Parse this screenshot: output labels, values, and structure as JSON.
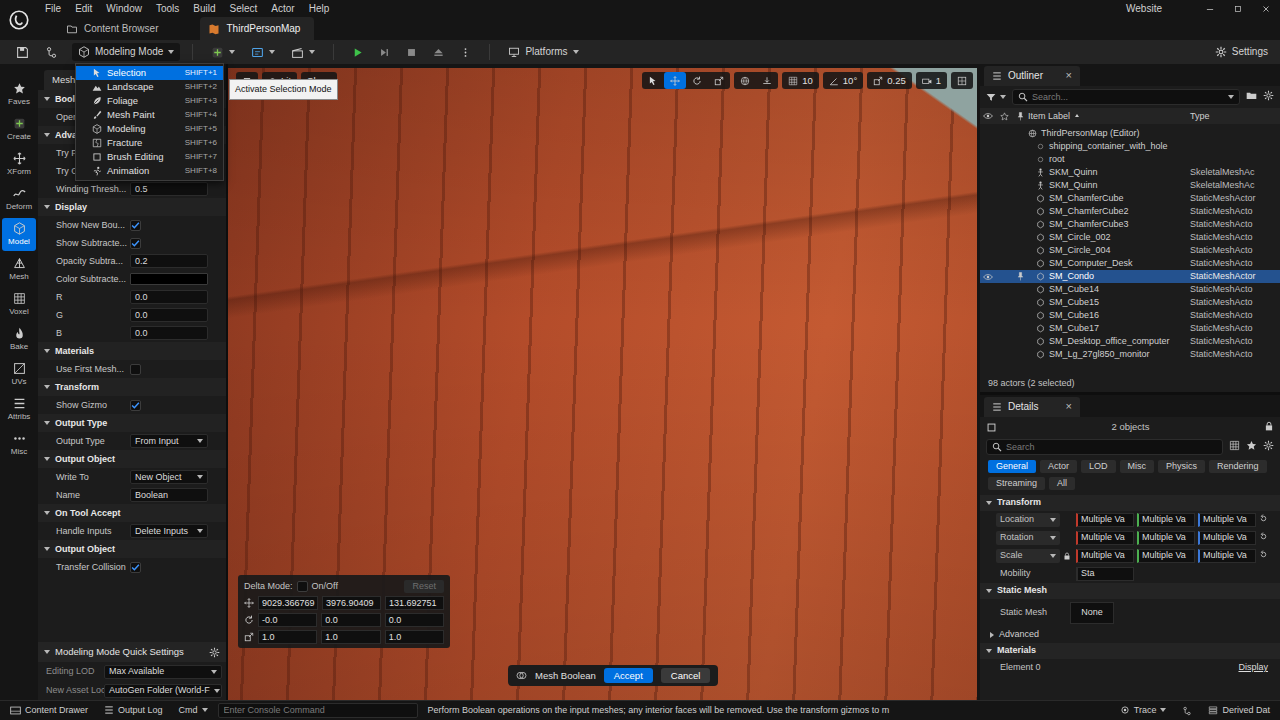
{
  "menu_bar": {
    "items": [
      "File",
      "Edit",
      "Window",
      "Tools",
      "Build",
      "Select",
      "Actor",
      "Help"
    ],
    "website": "Website"
  },
  "doc_tabs": [
    {
      "label": "Content Browser",
      "selected": false
    },
    {
      "label": "ThirdPersonMap",
      "selected": true
    }
  ],
  "toolbar": {
    "mode": "Modeling Mode",
    "platforms": "Platforms",
    "settings": "Settings"
  },
  "mode_menu": {
    "items": [
      {
        "label": "Selection",
        "shortcut": "SHIFT+1",
        "selected": true
      },
      {
        "label": "Landscape",
        "shortcut": "SHIFT+2",
        "selected": false
      },
      {
        "label": "Foliage",
        "shortcut": "SHIFT+3",
        "selected": false
      },
      {
        "label": "Mesh Paint",
        "shortcut": "SHIFT+4",
        "selected": false
      },
      {
        "label": "Modeling",
        "shortcut": "SHIFT+5",
        "selected": false
      },
      {
        "label": "Fracture",
        "shortcut": "SHIFT+6",
        "selected": false
      },
      {
        "label": "Brush Editing",
        "shortcut": "SHIFT+7",
        "selected": false
      },
      {
        "label": "Animation",
        "shortcut": "SHIFT+8",
        "selected": false
      }
    ],
    "tooltip": "Activate Selection Mode"
  },
  "tool_strip": [
    {
      "label": "Faves",
      "selected": false
    },
    {
      "label": "Create",
      "selected": false
    },
    {
      "label": "XForm",
      "selected": false
    },
    {
      "label": "Deform",
      "selected": false
    },
    {
      "label": "Model",
      "selected": true
    },
    {
      "label": "Mesh",
      "selected": false
    },
    {
      "label": "Voxel",
      "selected": false
    },
    {
      "label": "Bake",
      "selected": false
    },
    {
      "label": "UVs",
      "selected": false
    },
    {
      "label": "Attribs",
      "selected": false
    },
    {
      "label": "Misc",
      "selected": false
    }
  ],
  "tool_panel": {
    "tab": "Mesh",
    "rows": [
      {
        "kind": "section",
        "label": "Boole"
      },
      {
        "kind": "label",
        "label": "Opera"
      },
      {
        "kind": "section",
        "label": "Advan"
      },
      {
        "kind": "label",
        "label": "Try Fi"
      },
      {
        "kind": "label",
        "label": "Try Cl"
      },
      {
        "kind": "number",
        "label": "Winding Thresh...",
        "value": "0.5"
      },
      {
        "kind": "section",
        "label": "Display"
      },
      {
        "kind": "check",
        "label": "Show New Bou...",
        "checked": true
      },
      {
        "kind": "check",
        "label": "Show Subtracte...",
        "checked": true
      },
      {
        "kind": "number",
        "label": "Opacity Subtra...",
        "value": "0.2"
      },
      {
        "kind": "swatch",
        "label": "Color Subtracte...",
        "color": "#000000"
      },
      {
        "kind": "number",
        "label": "R",
        "value": "0.0"
      },
      {
        "kind": "number",
        "label": "G",
        "value": "0.0"
      },
      {
        "kind": "number",
        "label": "B",
        "value": "0.0"
      },
      {
        "kind": "section",
        "label": "Materials"
      },
      {
        "kind": "check",
        "label": "Use First Mesh...",
        "checked": false
      },
      {
        "kind": "section",
        "label": "Transform"
      },
      {
        "kind": "check",
        "label": "Show Gizmo",
        "checked": true
      },
      {
        "kind": "section",
        "label": "Output Type"
      },
      {
        "kind": "select",
        "label": "Output Type",
        "value": "From Input"
      },
      {
        "kind": "section",
        "label": "Output Object"
      },
      {
        "kind": "select",
        "label": "Write To",
        "value": "New Object"
      },
      {
        "kind": "text",
        "label": "Name",
        "value": "Boolean"
      },
      {
        "kind": "section",
        "label": "On Tool Accept"
      },
      {
        "kind": "select",
        "label": "Handle Inputs",
        "value": "Delete Inputs"
      },
      {
        "kind": "section",
        "label": "Output Object"
      },
      {
        "kind": "check",
        "label": "Transfer Collision",
        "checked": true
      }
    ]
  },
  "quick_settings": {
    "title": "Modeling Mode Quick Settings",
    "rows": [
      {
        "label": "Editing LOD",
        "value": "Max Available"
      },
      {
        "label": "New Asset Loc",
        "value": "AutoGen Folder (World-F"
      }
    ]
  },
  "viewport": {
    "view_buttons": [
      "Lit",
      "Show"
    ],
    "gizmo_tools": [
      {
        "selected": false
      },
      {
        "selected": true
      },
      {
        "selected": false
      },
      {
        "selected": false
      }
    ],
    "snaps": [
      "10",
      "10°",
      "0.25",
      "1"
    ]
  },
  "delta": {
    "label": "Delta Mode:",
    "enabled": false,
    "toggle": "On/Off",
    "reset": "Reset",
    "reset_disabled": true,
    "rows": [
      [
        "9029.366769",
        "3976.90409",
        "131.692751"
      ],
      [
        "-0.0",
        "0.0",
        "0.0"
      ],
      [
        "1.0",
        "1.0",
        "1.0"
      ]
    ]
  },
  "tool_actions": {
    "tool": "Mesh Boolean",
    "accept": "Accept",
    "cancel": "Cancel"
  },
  "outliner": {
    "title": "Outliner",
    "close": "×",
    "search_placeholder": "Search...",
    "columns": [
      "Item Label",
      "Type"
    ],
    "rows": [
      {
        "label": "ThirdPersonMap (Editor)",
        "kind": "world",
        "selected": false,
        "hovered": false
      },
      {
        "label": "shipping_container_with_hole",
        "kind": "plain",
        "selected": false,
        "hovered": false
      },
      {
        "label": "root",
        "kind": "plain",
        "selected": false,
        "hovered": false
      },
      {
        "label": "SKM_Quinn",
        "type": "SkeletalMeshAc",
        "kind": "skeletal",
        "selected": false,
        "hovered": false
      },
      {
        "label": "SKM_Quinn",
        "type": "SkeletalMeshAc",
        "kind": "skeletal",
        "selected": false,
        "hovered": false
      },
      {
        "label": "SM_ChamferCube",
        "type": "StaticMeshActor",
        "kind": "static",
        "selected": false,
        "hovered": false
      },
      {
        "label": "SM_ChamferCube2",
        "type": "StaticMeshActo",
        "kind": "static",
        "selected": false,
        "hovered": false
      },
      {
        "label": "SM_ChamferCube3",
        "type": "StaticMeshActo",
        "kind": "static",
        "selected": false,
        "hovered": false
      },
      {
        "label": "SM_Circle_002",
        "type": "StaticMeshActo",
        "kind": "static",
        "selected": false,
        "hovered": false
      },
      {
        "label": "SM_Circle_004",
        "type": "StaticMeshActo",
        "kind": "static",
        "selected": false,
        "hovered": false
      },
      {
        "label": "SM_Computer_Desk",
        "type": "StaticMeshActo",
        "kind": "static",
        "selected": false,
        "hovered": false
      },
      {
        "label": "SM_Condo",
        "type": "StaticMeshActor",
        "kind": "static",
        "selected": true,
        "hovered": true
      },
      {
        "label": "SM_Cube14",
        "type": "StaticMeshActo",
        "kind": "static",
        "selected": false,
        "hovered": false
      },
      {
        "label": "SM_Cube15",
        "type": "StaticMeshActo",
        "kind": "static",
        "selected": false,
        "hovered": false
      },
      {
        "label": "SM_Cube16",
        "type": "StaticMeshActo",
        "kind": "static",
        "selected": false,
        "hovered": false
      },
      {
        "label": "SM_Cube17",
        "type": "StaticMeshActo",
        "kind": "static",
        "selected": false,
        "hovered": false
      },
      {
        "label": "SM_Desktop_office_computer",
        "type": "StaticMeshActo",
        "kind": "static",
        "selected": false,
        "hovered": false
      },
      {
        "label": "SM_Lg_27gl850_monitor",
        "type": "StaticMeshActo",
        "kind": "static",
        "selected": false,
        "hovered": false
      }
    ],
    "footer": "98 actors (2 selected)"
  },
  "details": {
    "title": "Details",
    "close": "×",
    "objects": "2 objects",
    "search_placeholder": "Search",
    "filters": [
      {
        "label": "General",
        "selected": true
      },
      {
        "label": "Actor",
        "selected": false
      },
      {
        "label": "LOD",
        "selected": false
      },
      {
        "label": "Misc",
        "selected": false
      },
      {
        "label": "Physics",
        "selected": false
      },
      {
        "label": "Rendering",
        "selected": false
      },
      {
        "label": "Streaming",
        "selected": false
      },
      {
        "label": "All",
        "selected": false
      }
    ],
    "transform": {
      "title": "Transform",
      "rows": [
        {
          "label": "Location",
          "values": [
            "Multiple Va",
            "Multiple Va",
            "Multiple Va"
          ],
          "locked": false
        },
        {
          "label": "Rotation",
          "values": [
            "Multiple Va",
            "Multiple Va",
            "Multiple Va"
          ],
          "locked": false
        },
        {
          "label": "Scale",
          "values": [
            "Multiple Va",
            "Multiple Va",
            "Multiple Va"
          ],
          "locked": true
        }
      ],
      "mobility": {
        "label": "Mobility",
        "value": "Sta"
      }
    },
    "static_mesh": {
      "title": "Static Mesh",
      "label": "Static Mesh",
      "value": "None"
    },
    "advanced": "Advanced",
    "materials": {
      "title": "Materials",
      "label": "Element 0",
      "value": "Display"
    }
  },
  "status_bar": {
    "content_drawer": "Content Drawer",
    "output_log": "Output Log",
    "cmd": "Cmd",
    "console_placeholder": "Enter Console Command",
    "message": "Perform Boolean operations on the input meshes; any interior faces will be removed. Use the transform gizmos to m",
    "trace": "Trace",
    "derived_data": "Derived Dat"
  }
}
